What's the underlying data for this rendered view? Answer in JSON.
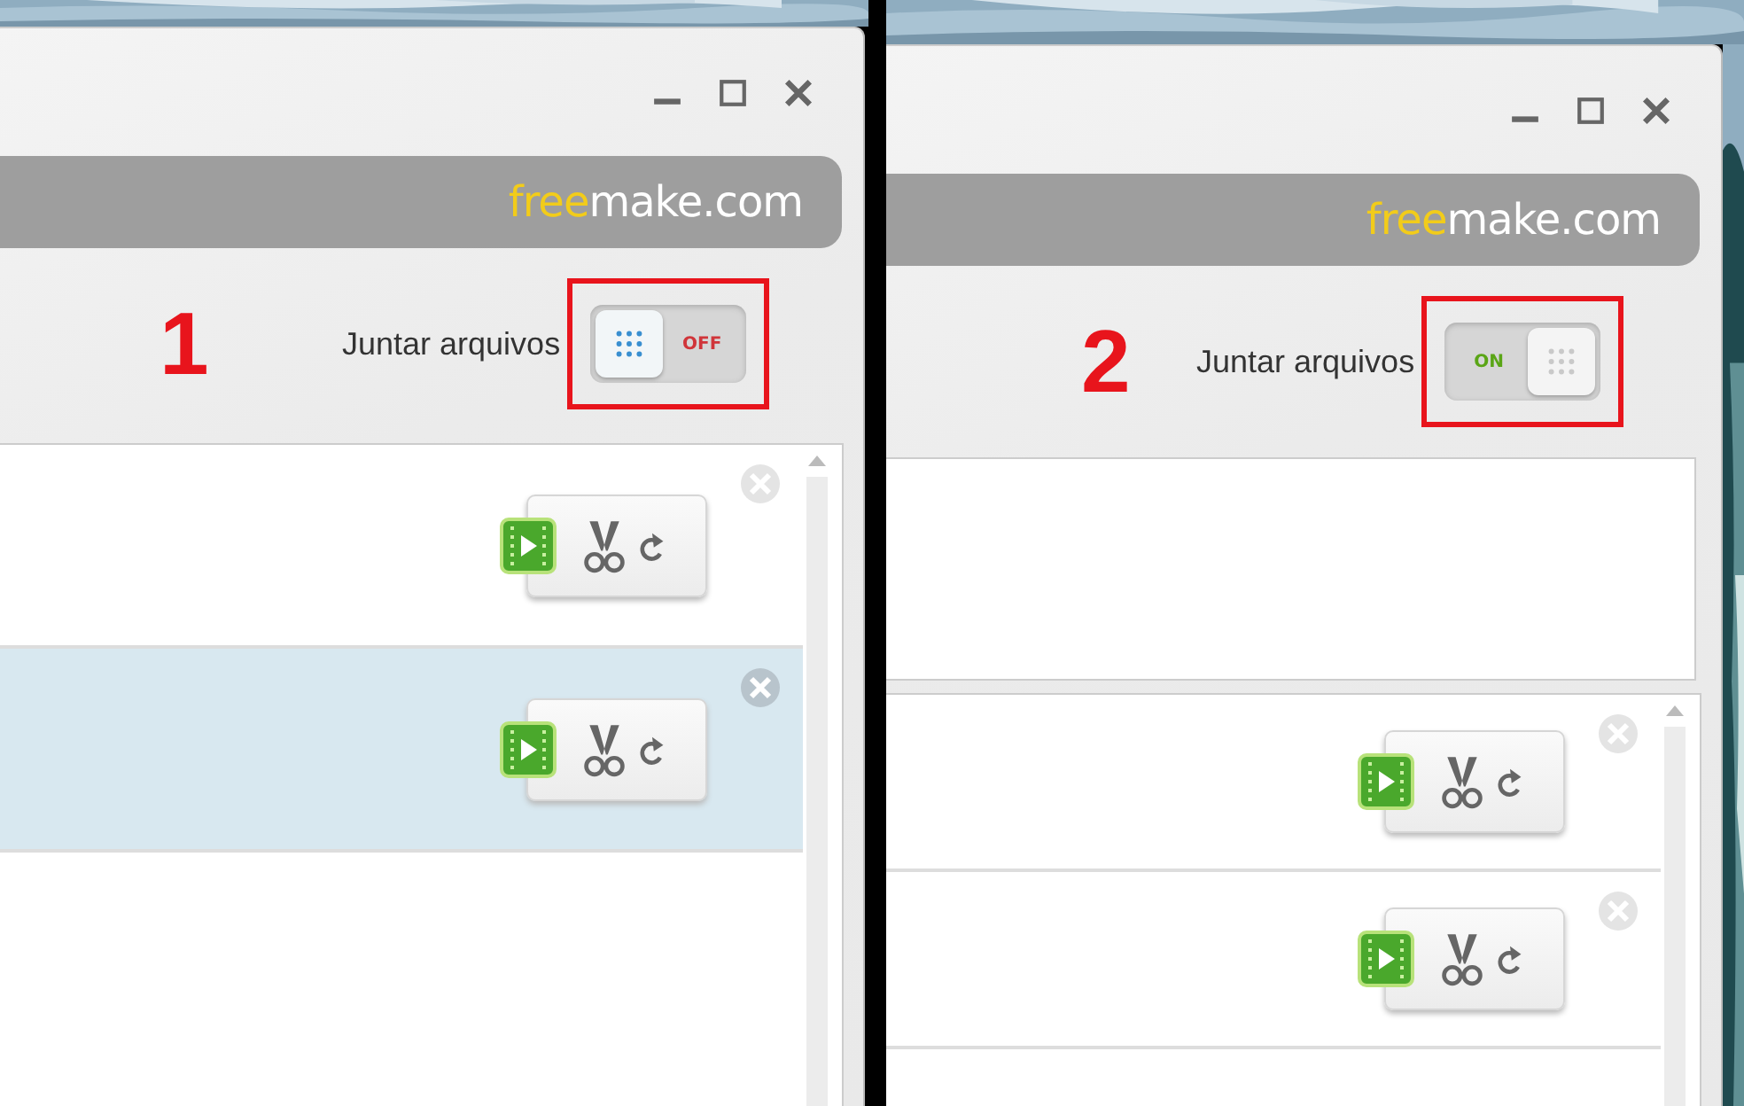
{
  "panels": [
    {
      "number": "1",
      "window_controls": [
        {
          "kind": "minimize"
        },
        {
          "kind": "maximize"
        },
        {
          "kind": "close"
        }
      ],
      "logo": {
        "accent": "free",
        "rest": "make.com"
      },
      "merge": {
        "label": "Juntar arquivos",
        "on": false,
        "state_text": "OFF"
      },
      "top_pane": false,
      "files": [
        {
          "selected": false
        },
        {
          "selected": true
        }
      ]
    },
    {
      "number": "2",
      "window_controls": [
        {
          "kind": "minimize"
        },
        {
          "kind": "maximize"
        },
        {
          "kind": "close"
        }
      ],
      "logo": {
        "accent": "free",
        "rest": "make.com"
      },
      "merge": {
        "label": "Juntar arquivos",
        "on": true,
        "state_text": "ON"
      },
      "top_pane": true,
      "files": [
        {
          "selected": false
        },
        {
          "selected": false
        }
      ]
    }
  ]
}
